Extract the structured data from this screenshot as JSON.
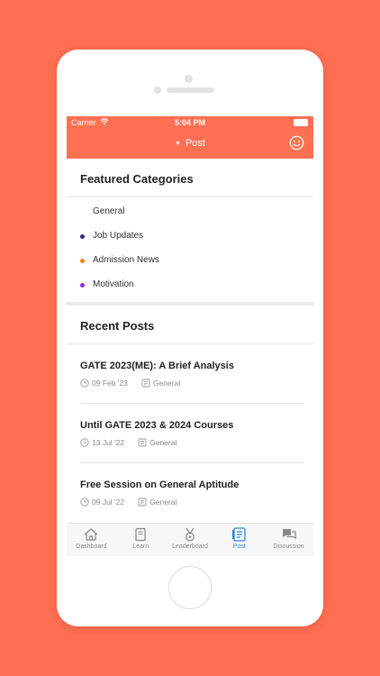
{
  "status": {
    "carrier": "Carrier",
    "time": "5:04 PM"
  },
  "nav": {
    "title": "Post"
  },
  "featured": {
    "title": "Featured Categories",
    "items": [
      {
        "label": "General",
        "color": ""
      },
      {
        "label": "Job Updates",
        "color": "#2c2a7a"
      },
      {
        "label": "Admission News",
        "color": "#F5821F"
      },
      {
        "label": "Motivation",
        "color": "#8A2BE2"
      }
    ]
  },
  "recent": {
    "title": "Recent Posts",
    "posts": [
      {
        "title": "GATE 2023(ME): A Brief Analysis",
        "date": "09 Feb '23",
        "category": "General"
      },
      {
        "title": "Until GATE 2023 & 2024 Courses",
        "date": "13 Jul '22",
        "category": "General"
      },
      {
        "title": "Free Session on General Aptitude",
        "date": "09 Jul '22",
        "category": "General"
      }
    ]
  },
  "tabs": [
    {
      "label": "Dashboard",
      "icon": "home-icon",
      "active": false
    },
    {
      "label": "Learn",
      "icon": "book-icon",
      "active": false
    },
    {
      "label": "Leaderboard",
      "icon": "medal-icon",
      "active": false
    },
    {
      "label": "Post",
      "icon": "document-icon",
      "active": true
    },
    {
      "label": "Discussion",
      "icon": "chat-icon",
      "active": false
    }
  ],
  "colors": {
    "accent": "#FF6F52",
    "active_tab": "#2E86DE"
  }
}
